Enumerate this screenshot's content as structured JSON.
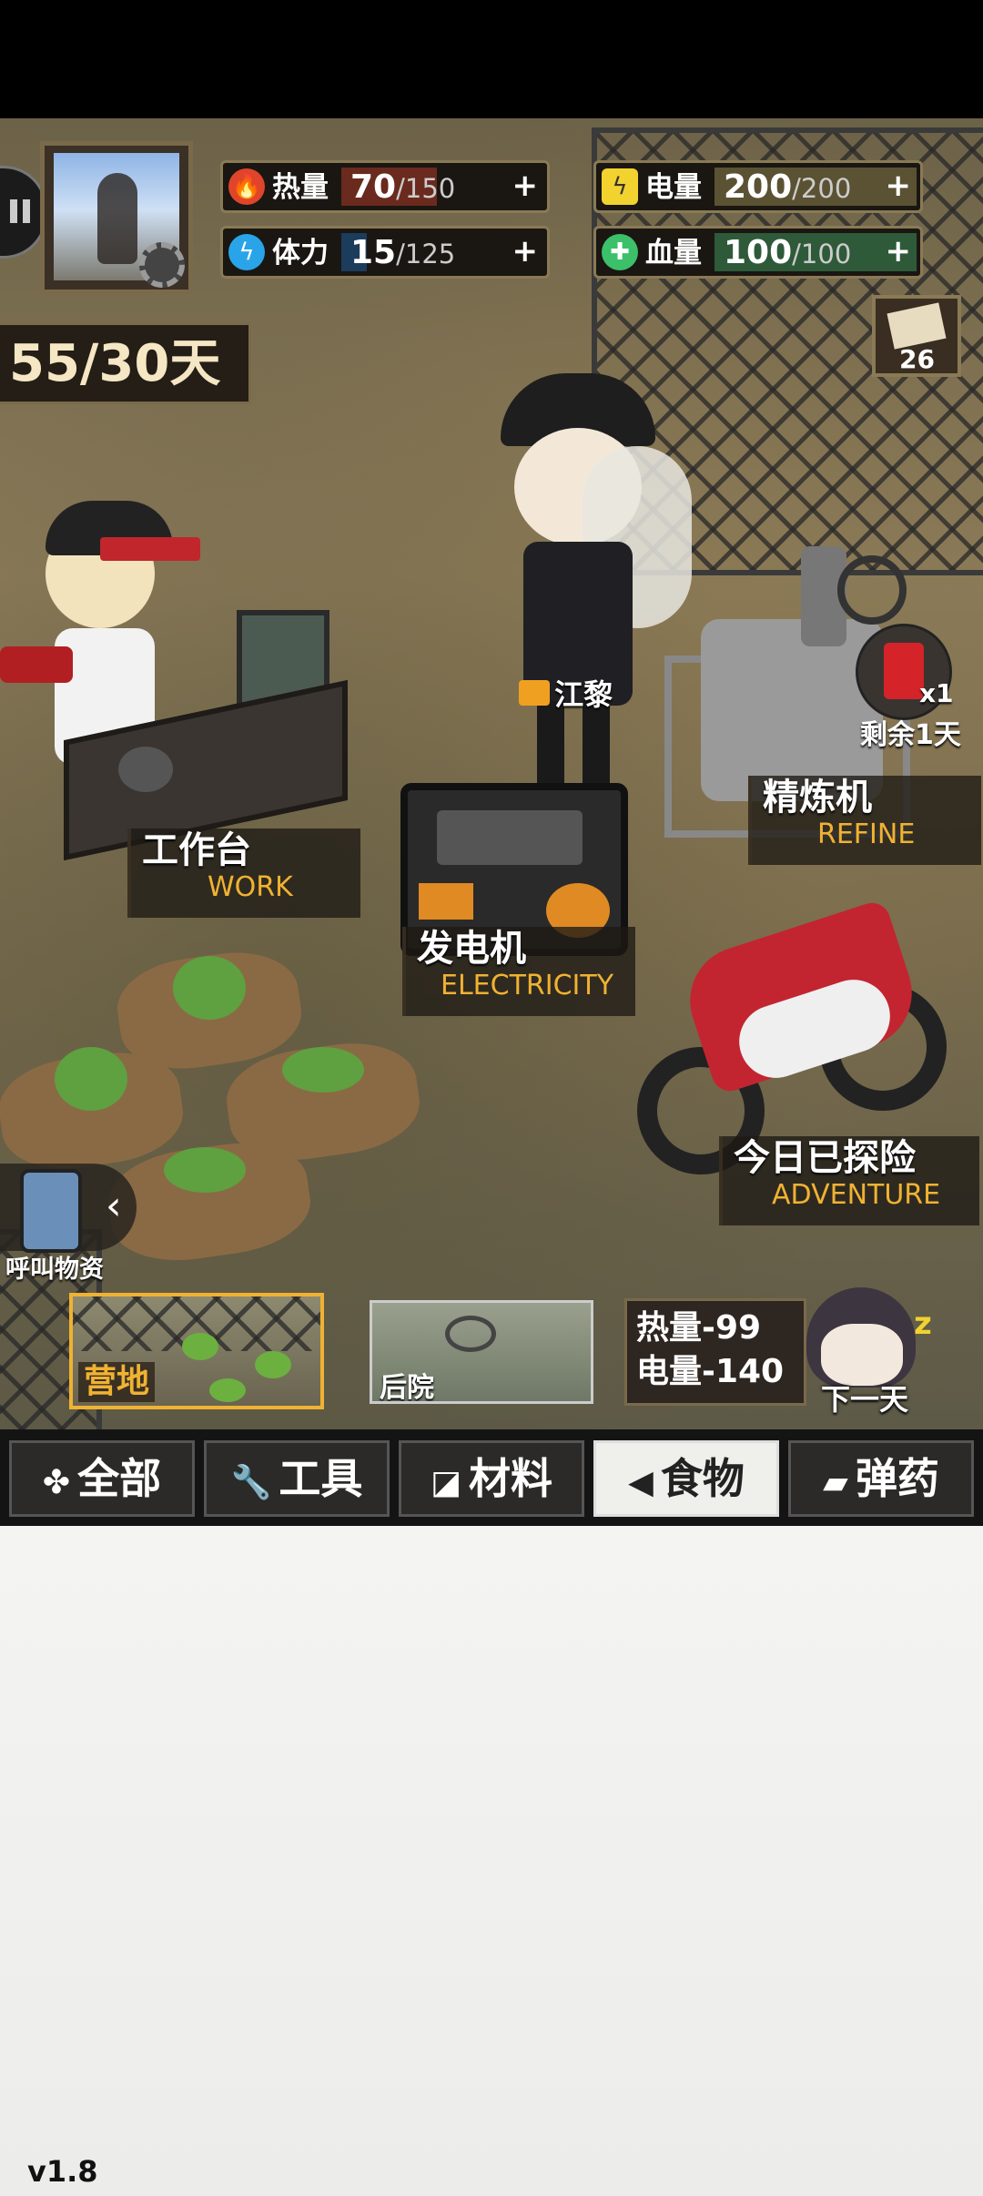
{
  "hud": {
    "heat": {
      "label": "热量",
      "value": "70",
      "max": "/150",
      "plus": "+",
      "fill": 0.47
    },
    "stamina": {
      "label": "体力",
      "value": "15",
      "max": "/125",
      "plus": "+",
      "fill": 0.12
    },
    "power": {
      "label": "电量",
      "value": "200",
      "max": "/200",
      "plus": "+",
      "fill": 1.0
    },
    "health": {
      "label": "血量",
      "value": "100",
      "max": "/100",
      "plus": "+",
      "fill": 1.0
    },
    "days": "55/30天",
    "mail_count": "26"
  },
  "scene": {
    "character_name": "江黎",
    "refine_bonus": "x1",
    "refine_remaining": "剩余1天",
    "call_supply": "呼叫物资",
    "stations": [
      {
        "cn": "工作台",
        "en": "WORK"
      },
      {
        "cn": "发电机",
        "en": "ELECTRICITY"
      },
      {
        "cn": "精炼机",
        "en": "REFINE"
      },
      {
        "cn": "今日已探险",
        "en": "ADVENTURE"
      }
    ]
  },
  "locations": {
    "camp": "营地",
    "backyard": "后院"
  },
  "next_day": {
    "heat_cost": "热量-99",
    "power_cost": "电量-140",
    "label": "下一天"
  },
  "tabs": [
    {
      "label": "全部",
      "icon": "✤"
    },
    {
      "label": "工具",
      "icon": "🔧"
    },
    {
      "label": "材料",
      "icon": "◪"
    },
    {
      "label": "食物",
      "icon": "◀"
    },
    {
      "label": "弹药",
      "icon": "▰"
    }
  ],
  "version": "v1.8",
  "colors": {
    "heat": "#e0452b",
    "stamina": "#2aa4e8",
    "power": "#f2d22e",
    "health": "#3cc06a",
    "accent": "#f0b232"
  }
}
